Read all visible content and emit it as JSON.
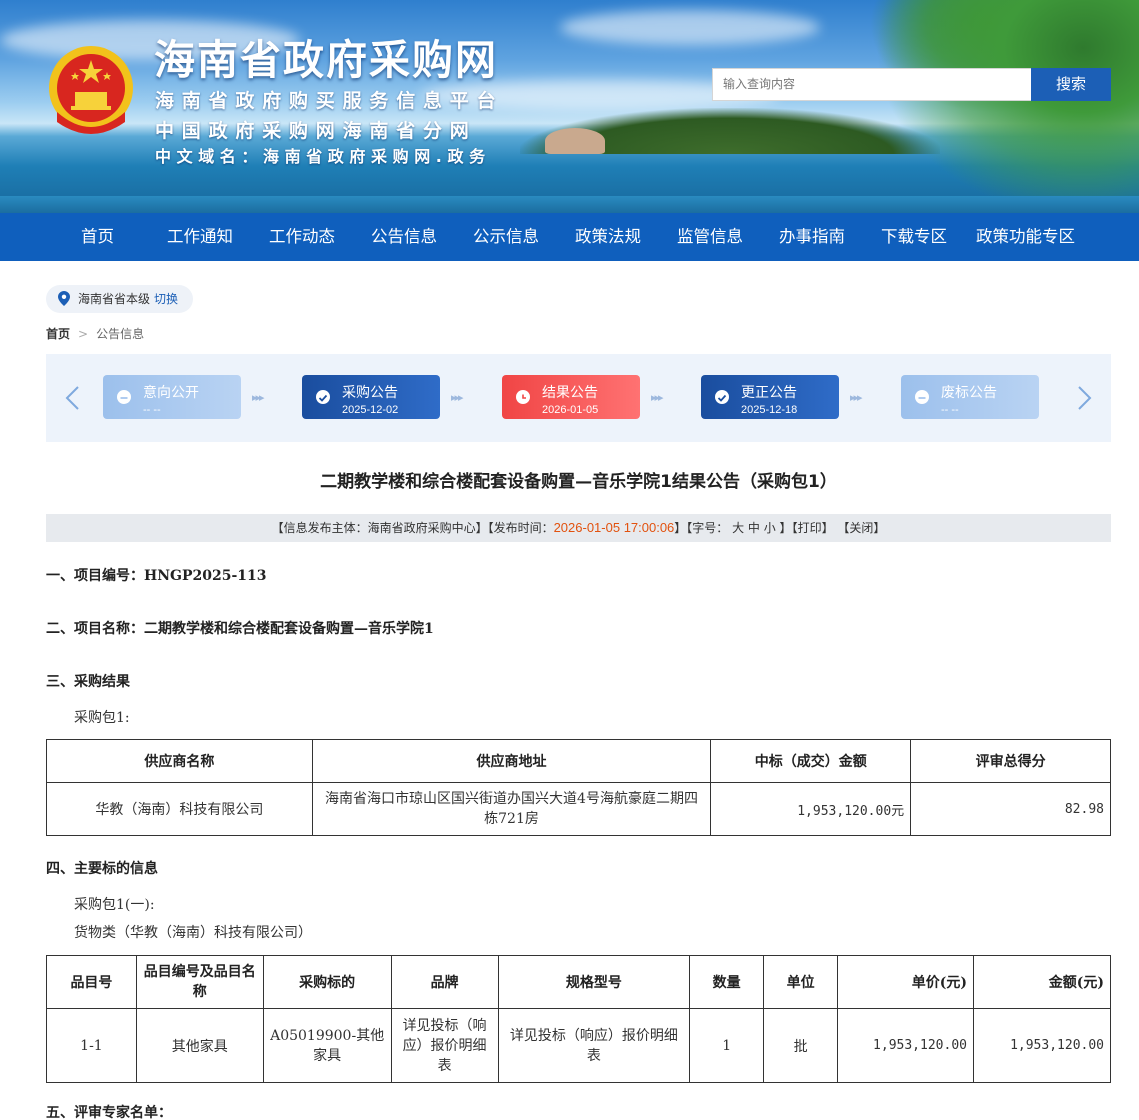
{
  "header": {
    "site_title": "海南省政府采购网",
    "subtitle_1": "海南省政府购买服务信息平台",
    "subtitle_2": "中国政府采购网海南省分网",
    "subtitle_3": "中文域名：海南省政府采购网.政务",
    "search_placeholder": "输入查询内容",
    "search_button": "搜索"
  },
  "nav": [
    "首页",
    "工作通知",
    "工作动态",
    "公告信息",
    "公示信息",
    "政策法规",
    "监管信息",
    "办事指南",
    "下载专区",
    "政策功能专区"
  ],
  "location": {
    "region": "海南省省本级",
    "switch": "切换"
  },
  "breadcrumb": {
    "home": "首页",
    "current": "公告信息"
  },
  "timeline": [
    {
      "name": "意向公开",
      "date": "-- --",
      "state": "gray"
    },
    {
      "name": "采购公告",
      "date": "2025-12-02",
      "state": "blue"
    },
    {
      "name": "结果公告",
      "date": "2026-01-05",
      "state": "red"
    },
    {
      "name": "更正公告",
      "date": "2025-12-18",
      "state": "blue"
    },
    {
      "name": "废标公告",
      "date": "-- --",
      "state": "gray"
    }
  ],
  "doc": {
    "title": "二期教学楼和综合楼配套设备购置—音乐学院1结果公告（采购包1）",
    "meta": {
      "publisher_prefix": "【信息发布主体：海南省政府采购中心】【发布时间：",
      "publish_time": "2026-01-05 17:00:06",
      "font_size_part": "】【字号： 大 中 小 】",
      "print": "【打印】",
      "close": "【关闭】"
    },
    "s1": "一、项目编号：HNGP2025-113",
    "s2": "二、项目名称：二期教学楼和综合楼配套设备购置—音乐学院1",
    "s3": "三、采购结果",
    "s3_pkg": "采购包1:",
    "result_table": {
      "headers": [
        "供应商名称",
        "供应商地址",
        "中标（成交）金额",
        "评审总得分"
      ],
      "rows": [
        [
          "华教（海南）科技有限公司",
          "海南省海口市琼山区国兴街道办国兴大道4号海航豪庭二期四栋721房",
          "1,953,120.00元",
          "82.98"
        ]
      ]
    },
    "s4": "四、主要标的信息",
    "s4_pkg": "采购包1(一):",
    "s4_type": "货物类（华教（海南）科技有限公司）",
    "item_table": {
      "headers": [
        "品目号",
        "品目编号及品目名称",
        "采购标的",
        "品牌",
        "规格型号",
        "数量",
        "单位",
        "单价(元)",
        "金额(元)"
      ],
      "rows": [
        [
          "1-1",
          "其他家具",
          "A05019900-其他家具",
          "详见投标（响应）报价明细表",
          "详见投标（响应）报价明细表",
          "1",
          "批",
          "1,953,120.00",
          "1,953,120.00"
        ]
      ]
    },
    "s5": "五、评审专家名单："
  }
}
